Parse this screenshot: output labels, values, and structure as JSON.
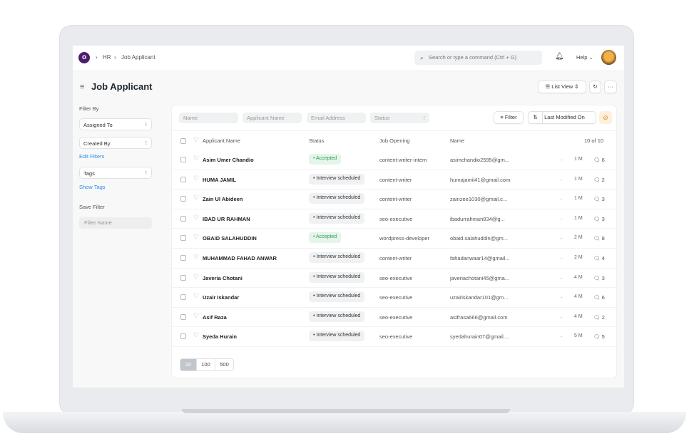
{
  "breadcrumb": [
    "HR",
    "Job Applicant"
  ],
  "search": {
    "placeholder": "Search or type a command (Ctrl + G)"
  },
  "help_label": "Help",
  "page_title": "Job Applicant",
  "toolbar": {
    "list_view": "List View",
    "refresh": "↻",
    "more": "···"
  },
  "sidebar": {
    "filter_by": "Filter By",
    "assigned_to": "Assigned To",
    "created_by": "Created By",
    "edit_filters": "Edit Filters",
    "tags": "Tags",
    "show_tags": "Show Tags",
    "save_filter": "Save Filter",
    "filter_name_placeholder": "Filter Name"
  },
  "filters": {
    "name": "Name",
    "applicant_name": "Applicant Name",
    "email": "Email Address",
    "status": "Status",
    "filter_btn": "Filter",
    "sort": "Last Modified On"
  },
  "columns": {
    "applicant_name": "Applicant Name",
    "status": "Status",
    "job_opening": "Job Opening",
    "name": "Name",
    "count": "10 of 10"
  },
  "rows": [
    {
      "name": "Asim Umer Chandio",
      "status": "Accepted",
      "job": "content-writer-intern",
      "email": "asimchandio2595@gm...",
      "modified": "1 M",
      "comments": "6"
    },
    {
      "name": "HUMA JAMIL",
      "status": "Interview scheduled",
      "job": "content-writer",
      "email": "humajamil41@gmail.com",
      "modified": "1 M",
      "comments": "2"
    },
    {
      "name": "Zain Ul Abideen",
      "status": "Interview scheduled",
      "job": "content-writer",
      "email": "zainzee1030@gmail.c...",
      "modified": "1 M",
      "comments": "3"
    },
    {
      "name": "IBAD UR RAHMAN",
      "status": "Interview scheduled",
      "job": "seo-executive",
      "email": "ibadurrahman834@g...",
      "modified": "1 M",
      "comments": "3"
    },
    {
      "name": "OBAID SALAHUDDIN",
      "status": "Accepted",
      "job": "wordpress-developer",
      "email": "obaid.salahuddin@gm...",
      "modified": "2 M",
      "comments": "8"
    },
    {
      "name": "MUHAMMAD FAHAD ANWAR",
      "status": "Interview scheduled",
      "job": "content-writer",
      "email": "fahadanwaar14@gmail...",
      "modified": "2 M",
      "comments": "4"
    },
    {
      "name": "Javeria Chotani",
      "status": "Interview scheduled",
      "job": "seo-executive",
      "email": "javeriachotani45@gma...",
      "modified": "4 M",
      "comments": "3"
    },
    {
      "name": "Uzair Iskandar",
      "status": "Interview scheduled",
      "job": "seo-executive",
      "email": "uzairiskandar101@gm...",
      "modified": "4 M",
      "comments": "6"
    },
    {
      "name": "Asif Raza",
      "status": "Interview scheduled",
      "job": "seo-executive",
      "email": "asifrasa666@gmail.com",
      "modified": "4 M",
      "comments": "2"
    },
    {
      "name": "Syeda Hurain",
      "status": "Interview scheduled",
      "job": "seo-executive",
      "email": "syedahurain07@gmail....",
      "modified": "5 M",
      "comments": "5"
    }
  ],
  "page_sizes": [
    "20",
    "100",
    "500"
  ],
  "colors": {
    "accent": "#4b1d6d",
    "link": "#2490ef",
    "accepted": "#2e9e56"
  }
}
